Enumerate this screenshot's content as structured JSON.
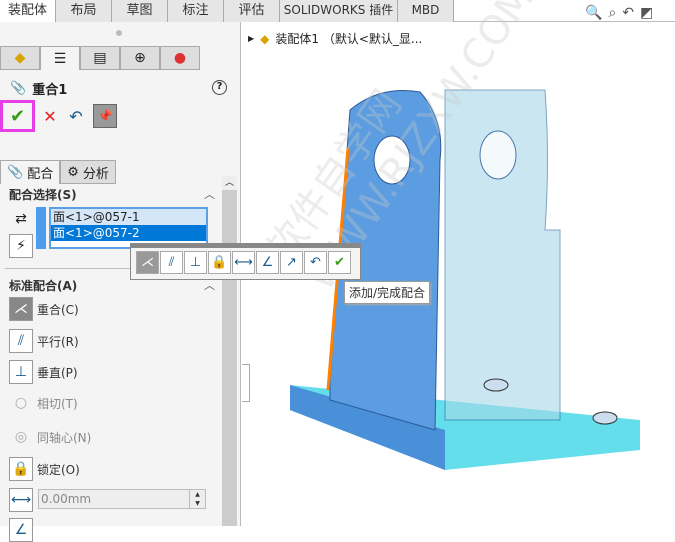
{
  "tabs": [
    "装配体",
    "布局",
    "草图",
    "标注",
    "评估",
    "SOLIDWORKS 插件",
    "MBD"
  ],
  "panel": {
    "title": "重合1",
    "help": "?",
    "subtabs": [
      "配合",
      "分析"
    ],
    "selection_header": "配合选择(S)",
    "selections": [
      "面<1>@057-1",
      "面<1>@057-2"
    ],
    "standard_header": "标准配合(A)",
    "mates": [
      {
        "label": "重合(C)",
        "icon": "coincident-icon",
        "selected": true,
        "enabled": true
      },
      {
        "label": "平行(R)",
        "icon": "parallel-icon",
        "selected": false,
        "enabled": true
      },
      {
        "label": "垂直(P)",
        "icon": "perpendicular-icon",
        "selected": false,
        "enabled": true
      },
      {
        "label": "相切(T)",
        "icon": "tangent-icon",
        "selected": false,
        "enabled": false
      },
      {
        "label": "同轴心(N)",
        "icon": "concentric-icon",
        "selected": false,
        "enabled": false
      },
      {
        "label": "锁定(O)",
        "icon": "lock-icon",
        "selected": false,
        "enabled": true
      }
    ],
    "distance": "0.00mm"
  },
  "tree": {
    "label": "装配体1 （默认<默认_显..."
  },
  "tooltip": "添加/完成配合",
  "watermark": "软件自学网 WWW.RJZXW.COM"
}
